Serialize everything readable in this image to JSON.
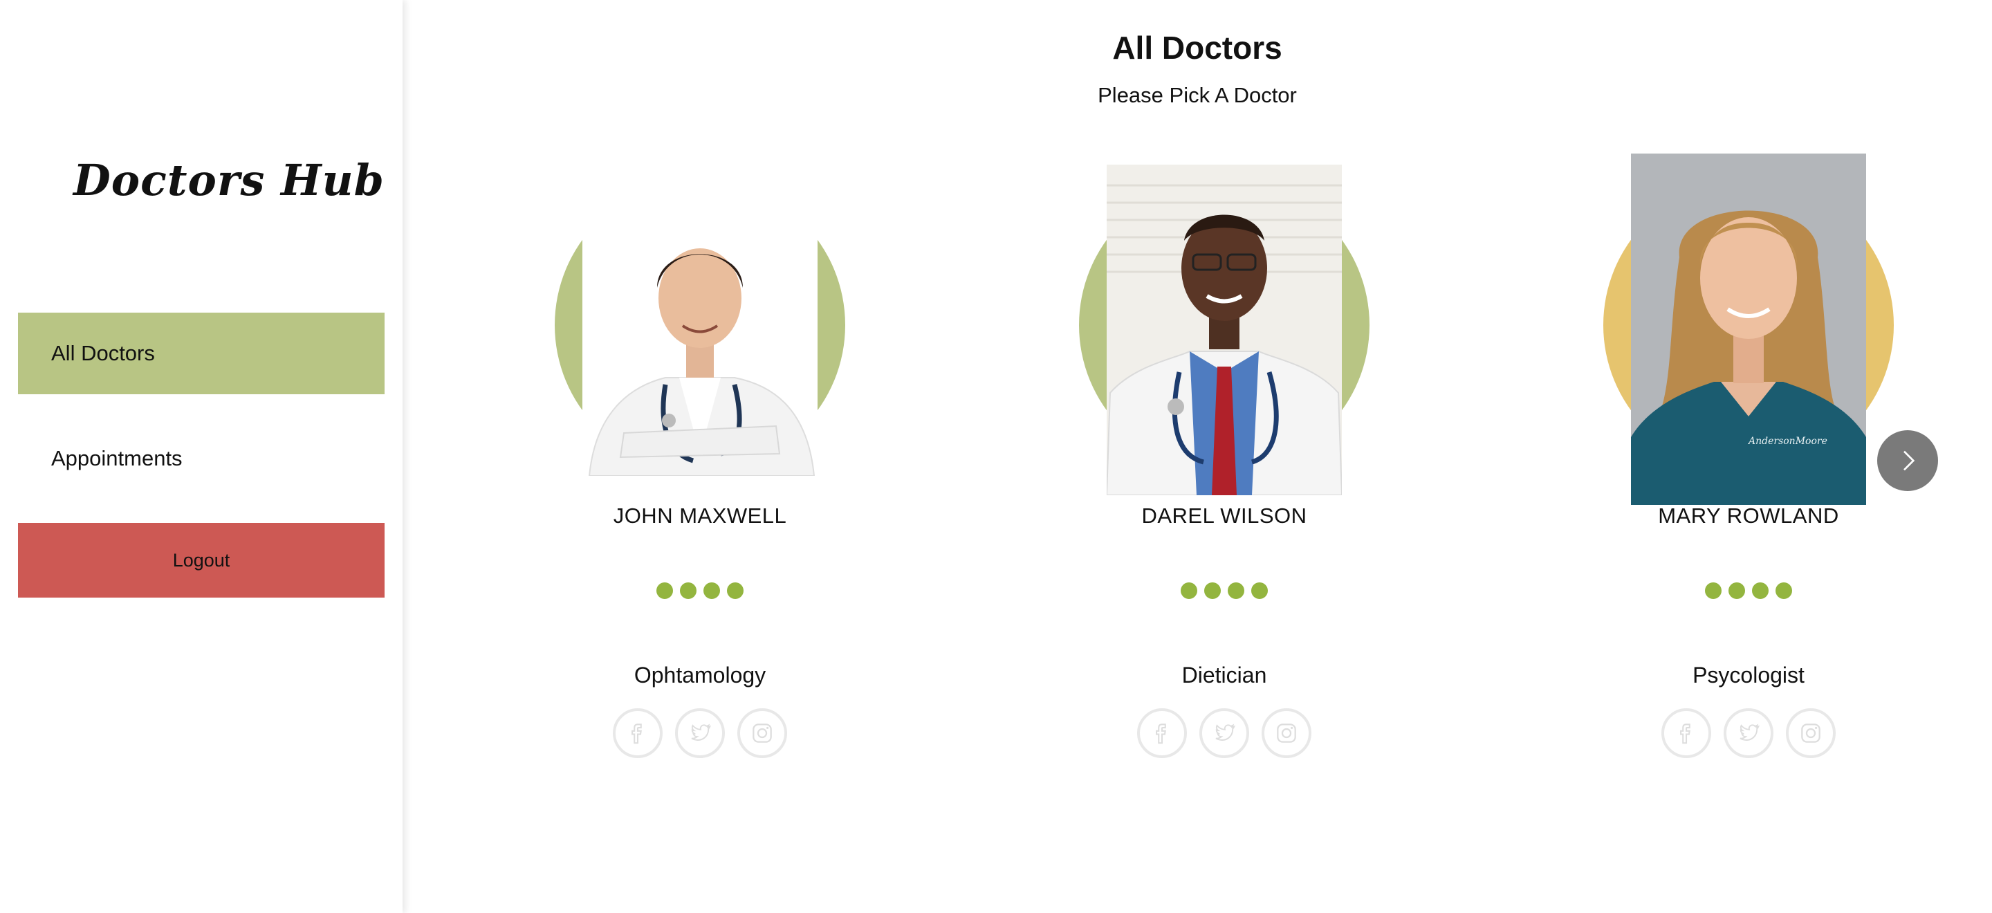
{
  "app": {
    "logo": "Doctors Hub"
  },
  "sidebar": {
    "items": [
      {
        "label": "All Doctors"
      },
      {
        "label": "Appointments"
      }
    ],
    "logout_label": "Logout"
  },
  "main": {
    "title": "All Doctors",
    "subtitle": "Please Pick A Doctor"
  },
  "doctors": [
    {
      "name": "JOHN MAXWELL",
      "speciality": "Ophtamology",
      "rating": 4,
      "blob_color": "#b8c584"
    },
    {
      "name": "DAREL WILSON",
      "speciality": "Dietician",
      "rating": 4,
      "blob_color": "#b8c584"
    },
    {
      "name": "MARY ROWLAND",
      "speciality": "Psycologist",
      "rating": 4,
      "blob_color": "#e6c46e"
    }
  ],
  "social_icons": [
    "facebook-icon",
    "twitter-icon",
    "instagram-icon"
  ],
  "carousel": {
    "next_icon": "chevron-right-icon"
  },
  "colors": {
    "active_nav": "#b8c584",
    "logout": "#cd5954",
    "rating_dot": "#93b53f",
    "social_border": "#e8e8e8",
    "next_button": "#7a7a7a"
  }
}
